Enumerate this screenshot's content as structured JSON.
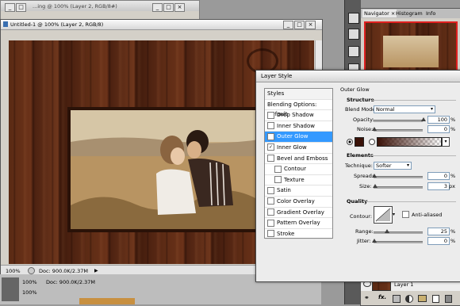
{
  "background_window": {
    "title": "...ing @ 100% (Layer 2, RGB/8#)"
  },
  "document": {
    "title": "Untitled-1 @ 100% (Layer 2, RGB/8)",
    "zoom": "100%",
    "doc_info": "Doc: 900.0K/2.37M"
  },
  "bottom_doc": {
    "zoom": "100%",
    "zoom2": "100%",
    "doc_info": "Doc: 900.0K/2.37M"
  },
  "navigator": {
    "tabs": [
      "Navigator ×",
      "Histogram",
      "Info"
    ]
  },
  "layers": {
    "layer_name": "Layer 1"
  },
  "layer_style": {
    "title": "Layer Style",
    "styles_header": "Styles",
    "list": [
      {
        "label": "Blending Options: Default",
        "checkbox": false,
        "checked": false,
        "selected": false,
        "indent": false
      },
      {
        "label": "Drop Shadow",
        "checkbox": true,
        "checked": false,
        "selected": false,
        "indent": false
      },
      {
        "label": "Inner Shadow",
        "checkbox": true,
        "checked": false,
        "selected": false,
        "indent": false
      },
      {
        "label": "Outer Glow",
        "checkbox": true,
        "checked": true,
        "selected": true,
        "indent": false
      },
      {
        "label": "Inner Glow",
        "checkbox": true,
        "checked": true,
        "selected": false,
        "indent": false
      },
      {
        "label": "Bevel and Emboss",
        "checkbox": true,
        "checked": false,
        "selected": false,
        "indent": false
      },
      {
        "label": "Contour",
        "checkbox": true,
        "checked": false,
        "selected": false,
        "indent": true
      },
      {
        "label": "Texture",
        "checkbox": true,
        "checked": false,
        "selected": false,
        "indent": true
      },
      {
        "label": "Satin",
        "checkbox": true,
        "checked": false,
        "selected": false,
        "indent": false
      },
      {
        "label": "Color Overlay",
        "checkbox": true,
        "checked": false,
        "selected": false,
        "indent": false
      },
      {
        "label": "Gradient Overlay",
        "checkbox": true,
        "checked": false,
        "selected": false,
        "indent": false
      },
      {
        "label": "Pattern Overlay",
        "checkbox": true,
        "checked": false,
        "selected": false,
        "indent": false
      },
      {
        "label": "Stroke",
        "checkbox": true,
        "checked": false,
        "selected": false,
        "indent": false
      }
    ],
    "outer_glow": {
      "section_title": "Outer Glow",
      "structure": {
        "title": "Structure",
        "blend_mode_label": "Blend Mode:",
        "blend_mode": "Normal",
        "opacity_label": "Opacity:",
        "opacity": "100",
        "opacity_level": 1.0,
        "noise_label": "Noise:",
        "noise": "0",
        "noise_level": 0.0,
        "percent": "%",
        "glow_color": "#3a1208"
      },
      "elements": {
        "title": "Elements",
        "technique_label": "Technique:",
        "technique": "Softer",
        "spread_label": "Spread:",
        "spread": "0",
        "spread_level": 0.0,
        "size_label": "Size:",
        "size": "3",
        "size_level": 0.02,
        "px": "px"
      },
      "quality": {
        "title": "Quality",
        "contour_label": "Contour:",
        "anti_aliased_label": "Anti-aliased",
        "range_label": "Range:",
        "range": "25",
        "range_level": 0.25,
        "jitter_label": "Jitter:",
        "jitter": "0",
        "jitter_level": 0.0
      }
    }
  },
  "colors": {
    "accent_selected": "#3399ff",
    "wood": "#5a2a14",
    "sepia": "#c9a97a"
  }
}
